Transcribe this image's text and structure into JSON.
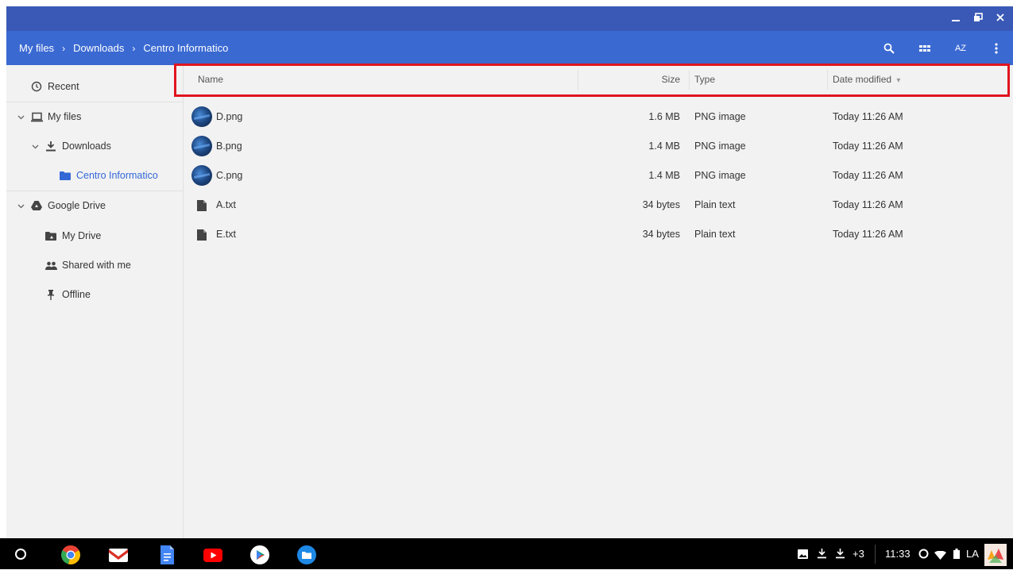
{
  "window": {
    "controls": [
      {
        "name": "minimize-icon",
        "glyph": "_"
      },
      {
        "name": "restore-icon",
        "glyph": "⧉"
      },
      {
        "name": "close-icon",
        "glyph": "✕"
      }
    ]
  },
  "header": {
    "breadcrumb": [
      "My files",
      "Downloads",
      "Centro Informatico"
    ],
    "separator": "›",
    "buttons": {
      "search": "search-icon",
      "grid_view": "grid-view-icon",
      "sort": "AZ",
      "more": "more-vert-icon"
    }
  },
  "sidebar": {
    "recent": "Recent",
    "my_files": "My files",
    "downloads": "Downloads",
    "current_folder": "Centro Informatico",
    "google_drive": "Google Drive",
    "my_drive": "My Drive",
    "shared_with_me": "Shared with me",
    "offline": "Offline"
  },
  "columns": {
    "name": "Name",
    "size": "Size",
    "type": "Type",
    "date": "Date modified",
    "sort_indicator": "▾"
  },
  "files": [
    {
      "name": "D.png",
      "size": "1.6 MB",
      "type": "PNG image",
      "date": "Today 11:26 AM",
      "kind": "image"
    },
    {
      "name": "B.png",
      "size": "1.4 MB",
      "type": "PNG image",
      "date": "Today 11:26 AM",
      "kind": "image"
    },
    {
      "name": "C.png",
      "size": "1.4 MB",
      "type": "PNG image",
      "date": "Today 11:26 AM",
      "kind": "image"
    },
    {
      "name": "A.txt",
      "size": "34 bytes",
      "type": "Plain text",
      "date": "Today 11:26 AM",
      "kind": "text"
    },
    {
      "name": "E.txt",
      "size": "34 bytes",
      "type": "Plain text",
      "date": "Today 11:26 AM",
      "kind": "text"
    }
  ],
  "shelf": {
    "notification_count": "+3",
    "clock": "11:33",
    "ime": "LA"
  },
  "colors": {
    "title_bar": "#3a59b6",
    "header": "#3a69d2",
    "accent": "#3367d6",
    "highlight": "#e0141e"
  }
}
